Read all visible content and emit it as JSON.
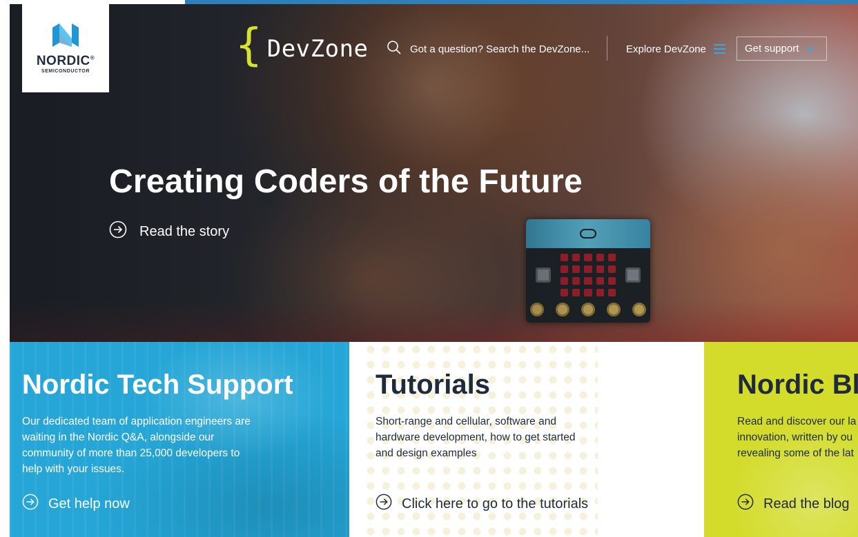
{
  "logo": {
    "word": "NORDIC",
    "registered": "®",
    "subtitle": "SEMICONDUCTOR",
    "icon": "nordic-n-logo-icon"
  },
  "brand": {
    "brace": "{",
    "name": "DevZone",
    "brace_color": "#d6e130"
  },
  "header": {
    "search": {
      "icon": "search-icon",
      "placeholder": "Got a question? Search the DevZone..."
    },
    "explore": {
      "label": "Explore DevZone",
      "icon": "hamburger-menu-icon"
    },
    "support": {
      "label": "Get support",
      "icon": "plus-icon"
    }
  },
  "hero": {
    "title": "Creating Coders of the Future",
    "link": {
      "label": "Read the story",
      "icon": "arrow-circle-right-icon"
    }
  },
  "panels": {
    "support": {
      "title": "Nordic Tech Support",
      "description": "Our dedicated team of application engineers are\nwaiting in the Nordic Q&A, alongside our\ncommunity of more than 25,000 developers to\nhelp with your issues.",
      "link": "Get help now",
      "color": "#25a6d6"
    },
    "tutorials": {
      "title": "Tutorials",
      "description": "Short-range and cellular, software and\nhardware development, how to get started\nand design examples",
      "link": "Click here to go to the tutorials",
      "color": "#ffffff"
    },
    "blog": {
      "title": "Nordic Blo",
      "description": "Read and discover our la\ninnovation, written by ou\nrevealing some of the lat",
      "link": "Read the blog",
      "color": "#d3dc2b"
    }
  },
  "colors": {
    "accent_blue": "#3aa6e0",
    "stripe": "#2f7fb8",
    "dark_text": "#1f2b3a"
  }
}
